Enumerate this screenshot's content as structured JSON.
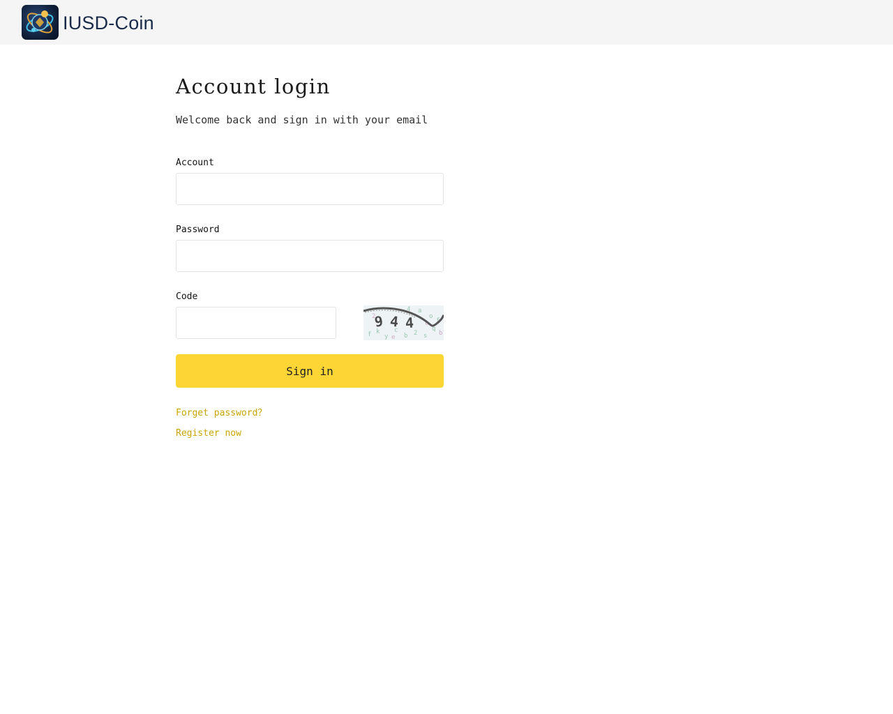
{
  "header": {
    "brand_name": "IUSD-Coin",
    "logo_icon": "globe-coin-logo-icon",
    "background_color": "#f5f5f5"
  },
  "login": {
    "title": "Account login",
    "subtitle": "Welcome back and sign in with your email",
    "account_label": "Account",
    "account_value": "",
    "account_placeholder": "",
    "password_label": "Password",
    "password_value": "",
    "password_placeholder": "",
    "code_label": "Code",
    "code_value": "",
    "code_placeholder": "",
    "captcha_text": "944",
    "signin_label": "Sign in",
    "signin_color": "#fdd535",
    "forget_password_label": "Forget password？",
    "register_label": "Register now",
    "link_color": "#c9a400"
  }
}
